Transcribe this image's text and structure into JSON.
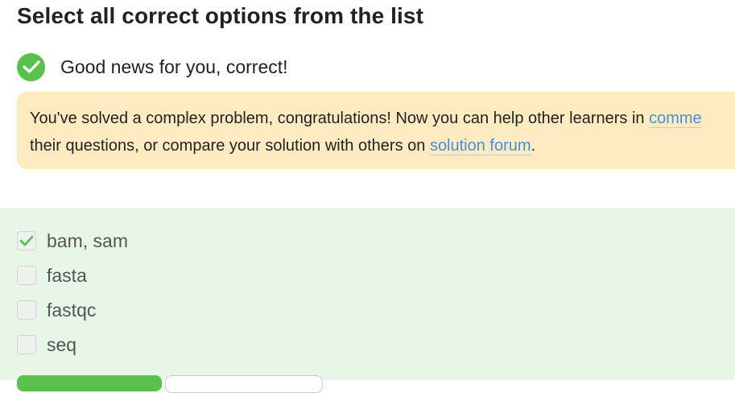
{
  "heading": "Select all correct options from the list",
  "result": {
    "icon": "check-circle-icon",
    "message": "Good news for you, correct!"
  },
  "notice": {
    "text_before_link": "You've solved a complex problem, congratulations! Now you can help other learners in ",
    "comments_link": "comme",
    "text_line2_start": "their questions, or compare your solution with others on ",
    "forum_link": "solution forum",
    "text_end": "."
  },
  "options": [
    {
      "label": "bam, sam",
      "checked": true
    },
    {
      "label": "fasta",
      "checked": false
    },
    {
      "label": "fastqc",
      "checked": false
    },
    {
      "label": "seq",
      "checked": false
    }
  ],
  "colors": {
    "success": "#58c24d",
    "notice_bg": "#feebc1",
    "options_bg": "#e8f6e8",
    "link": "#4a8fd6"
  }
}
